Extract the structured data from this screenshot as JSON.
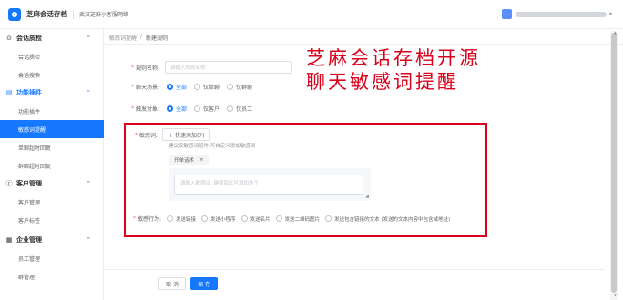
{
  "app": {
    "name": "芝麻会话存档",
    "corp": "武汉芝麻小客服网络"
  },
  "sidebar": {
    "groups": [
      {
        "label": "会话质检",
        "icon": "⊙",
        "items": [
          "会话质检",
          "会话搜索"
        ]
      },
      {
        "label": "功能插件",
        "icon": "▤",
        "items": [
          "功能插件",
          "敏感词提醒",
          "单聊超时回复",
          "群聊超时回复"
        ]
      },
      {
        "label": "客户管理",
        "icon": "ⓡ",
        "items": [
          "客户管理",
          "客户标签"
        ]
      },
      {
        "label": "企业管理",
        "icon": "▦",
        "items": [
          "员工管理",
          "群管理"
        ]
      }
    ]
  },
  "breadcrumb": {
    "parent": "敏感词提醒",
    "sep": "/",
    "current": "新建规则"
  },
  "form": {
    "rule_name_label": "规则名称:",
    "rule_name_placeholder": "请输入规则名称",
    "chat_scene_label": "聊天场景:",
    "chat_scene_options": [
      "全部",
      "仅单聊",
      "仅群聊"
    ],
    "trigger_label": "触发对象:",
    "trigger_options": [
      "全部",
      "仅客户",
      "仅员工"
    ],
    "sensitive_label": "敏感词:",
    "quick_add_label": "+ 快速添加(7)",
    "sensitive_hint": "建议仅敏感词组件,可自定义添加敏感词",
    "tag_label": "开单话术",
    "tag_close": "×",
    "textarea_placeholder": "请输入敏感词, 键盘回车可添加多个",
    "action_label": "敏感行为:",
    "action_options": [
      "发送链接",
      "发送小程序",
      "发送名片",
      "发送二维码图片",
      "发送包含链接的文本 (发送的文本内容中包含域地址)"
    ]
  },
  "footer": {
    "cancel": "取 消",
    "save": "保 存"
  },
  "overlay": {
    "line1": "芝麻会话存档开源",
    "line2": "聊天敏感词提醒"
  }
}
